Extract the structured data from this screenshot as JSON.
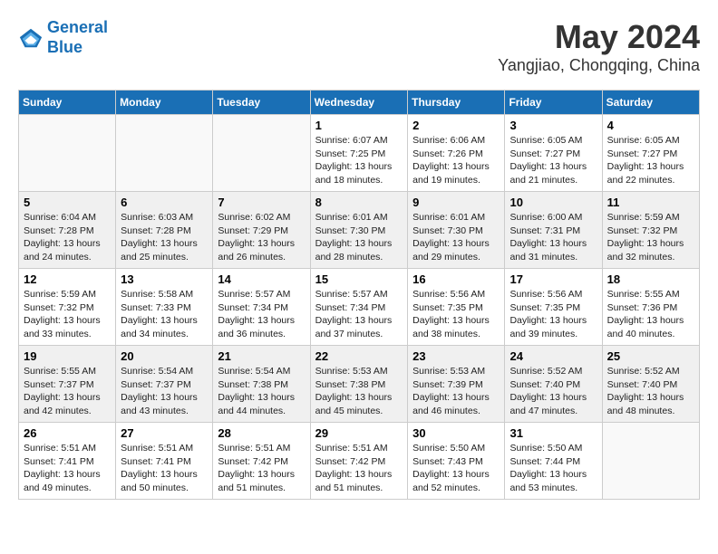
{
  "header": {
    "logo_line1": "General",
    "logo_line2": "Blue",
    "main_title": "May 2024",
    "subtitle": "Yangjiao, Chongqing, China"
  },
  "days_of_week": [
    "Sunday",
    "Monday",
    "Tuesday",
    "Wednesday",
    "Thursday",
    "Friday",
    "Saturday"
  ],
  "weeks": [
    [
      {
        "day": "",
        "info": ""
      },
      {
        "day": "",
        "info": ""
      },
      {
        "day": "",
        "info": ""
      },
      {
        "day": "1",
        "info": "Sunrise: 6:07 AM\nSunset: 7:25 PM\nDaylight: 13 hours\nand 18 minutes."
      },
      {
        "day": "2",
        "info": "Sunrise: 6:06 AM\nSunset: 7:26 PM\nDaylight: 13 hours\nand 19 minutes."
      },
      {
        "day": "3",
        "info": "Sunrise: 6:05 AM\nSunset: 7:27 PM\nDaylight: 13 hours\nand 21 minutes."
      },
      {
        "day": "4",
        "info": "Sunrise: 6:05 AM\nSunset: 7:27 PM\nDaylight: 13 hours\nand 22 minutes."
      }
    ],
    [
      {
        "day": "5",
        "info": "Sunrise: 6:04 AM\nSunset: 7:28 PM\nDaylight: 13 hours\nand 24 minutes."
      },
      {
        "day": "6",
        "info": "Sunrise: 6:03 AM\nSunset: 7:28 PM\nDaylight: 13 hours\nand 25 minutes."
      },
      {
        "day": "7",
        "info": "Sunrise: 6:02 AM\nSunset: 7:29 PM\nDaylight: 13 hours\nand 26 minutes."
      },
      {
        "day": "8",
        "info": "Sunrise: 6:01 AM\nSunset: 7:30 PM\nDaylight: 13 hours\nand 28 minutes."
      },
      {
        "day": "9",
        "info": "Sunrise: 6:01 AM\nSunset: 7:30 PM\nDaylight: 13 hours\nand 29 minutes."
      },
      {
        "day": "10",
        "info": "Sunrise: 6:00 AM\nSunset: 7:31 PM\nDaylight: 13 hours\nand 31 minutes."
      },
      {
        "day": "11",
        "info": "Sunrise: 5:59 AM\nSunset: 7:32 PM\nDaylight: 13 hours\nand 32 minutes."
      }
    ],
    [
      {
        "day": "12",
        "info": "Sunrise: 5:59 AM\nSunset: 7:32 PM\nDaylight: 13 hours\nand 33 minutes."
      },
      {
        "day": "13",
        "info": "Sunrise: 5:58 AM\nSunset: 7:33 PM\nDaylight: 13 hours\nand 34 minutes."
      },
      {
        "day": "14",
        "info": "Sunrise: 5:57 AM\nSunset: 7:34 PM\nDaylight: 13 hours\nand 36 minutes."
      },
      {
        "day": "15",
        "info": "Sunrise: 5:57 AM\nSunset: 7:34 PM\nDaylight: 13 hours\nand 37 minutes."
      },
      {
        "day": "16",
        "info": "Sunrise: 5:56 AM\nSunset: 7:35 PM\nDaylight: 13 hours\nand 38 minutes."
      },
      {
        "day": "17",
        "info": "Sunrise: 5:56 AM\nSunset: 7:35 PM\nDaylight: 13 hours\nand 39 minutes."
      },
      {
        "day": "18",
        "info": "Sunrise: 5:55 AM\nSunset: 7:36 PM\nDaylight: 13 hours\nand 40 minutes."
      }
    ],
    [
      {
        "day": "19",
        "info": "Sunrise: 5:55 AM\nSunset: 7:37 PM\nDaylight: 13 hours\nand 42 minutes."
      },
      {
        "day": "20",
        "info": "Sunrise: 5:54 AM\nSunset: 7:37 PM\nDaylight: 13 hours\nand 43 minutes."
      },
      {
        "day": "21",
        "info": "Sunrise: 5:54 AM\nSunset: 7:38 PM\nDaylight: 13 hours\nand 44 minutes."
      },
      {
        "day": "22",
        "info": "Sunrise: 5:53 AM\nSunset: 7:38 PM\nDaylight: 13 hours\nand 45 minutes."
      },
      {
        "day": "23",
        "info": "Sunrise: 5:53 AM\nSunset: 7:39 PM\nDaylight: 13 hours\nand 46 minutes."
      },
      {
        "day": "24",
        "info": "Sunrise: 5:52 AM\nSunset: 7:40 PM\nDaylight: 13 hours\nand 47 minutes."
      },
      {
        "day": "25",
        "info": "Sunrise: 5:52 AM\nSunset: 7:40 PM\nDaylight: 13 hours\nand 48 minutes."
      }
    ],
    [
      {
        "day": "26",
        "info": "Sunrise: 5:51 AM\nSunset: 7:41 PM\nDaylight: 13 hours\nand 49 minutes."
      },
      {
        "day": "27",
        "info": "Sunrise: 5:51 AM\nSunset: 7:41 PM\nDaylight: 13 hours\nand 50 minutes."
      },
      {
        "day": "28",
        "info": "Sunrise: 5:51 AM\nSunset: 7:42 PM\nDaylight: 13 hours\nand 51 minutes."
      },
      {
        "day": "29",
        "info": "Sunrise: 5:51 AM\nSunset: 7:42 PM\nDaylight: 13 hours\nand 51 minutes."
      },
      {
        "day": "30",
        "info": "Sunrise: 5:50 AM\nSunset: 7:43 PM\nDaylight: 13 hours\nand 52 minutes."
      },
      {
        "day": "31",
        "info": "Sunrise: 5:50 AM\nSunset: 7:44 PM\nDaylight: 13 hours\nand 53 minutes."
      },
      {
        "day": "",
        "info": ""
      }
    ]
  ]
}
